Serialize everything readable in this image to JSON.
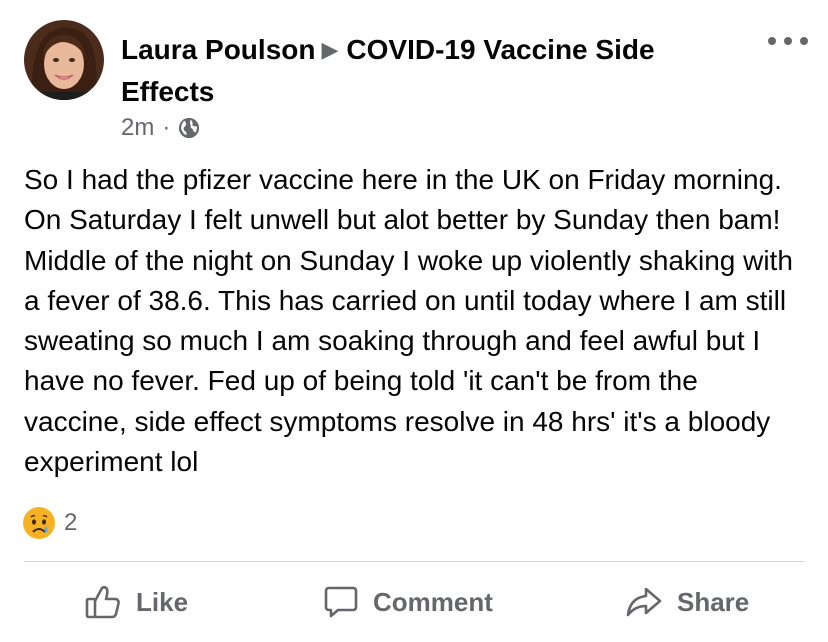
{
  "post": {
    "author": "Laura Poulson",
    "group": "COVID-19 Vaccine Side Effects",
    "separator": "▶",
    "time": "2m",
    "meta_dot": "·",
    "privacy_icon": "globe-icon",
    "text": "So I had the pfizer vaccine here in the UK on Friday morning. On Saturday I felt unwell but alot better by Sunday then bam! Middle of the night on Sunday I woke up violently shaking with a fever of 38.6. This has carried on until today where I am still sweating so much I am soaking through and feel awful but I have no fever. Fed up of being told 'it can't be from the vaccine, side effect symptoms resolve in 48 hrs' it's a bloody experiment lol"
  },
  "reactions": {
    "icon": "sad-reaction-icon",
    "count": "2"
  },
  "actions": {
    "like_label": "Like",
    "comment_label": "Comment",
    "share_label": "Share"
  },
  "colors": {
    "text": "#050505",
    "secondary": "#65676b",
    "divider": "#ced0d4",
    "reaction_face": "#f7b125"
  }
}
